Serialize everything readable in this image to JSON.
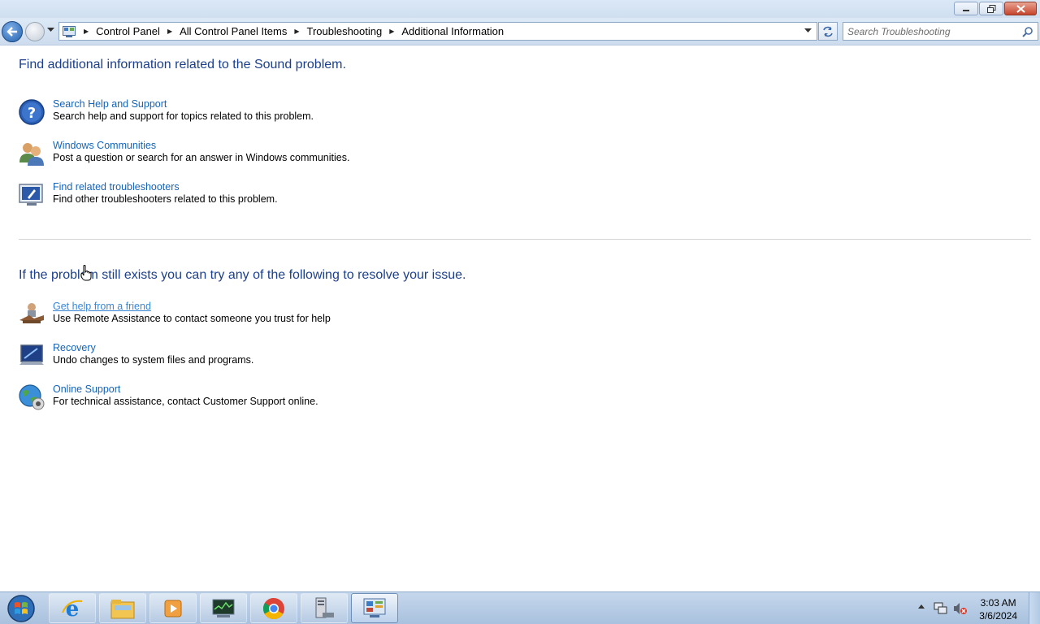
{
  "window": {
    "controls": [
      "minimize-icon",
      "restore-icon",
      "close-icon"
    ]
  },
  "address_bar": {
    "breadcrumbs": [
      "Control Panel",
      "All Control Panel Items",
      "Troubleshooting",
      "Additional Information"
    ]
  },
  "search": {
    "placeholder": "Search Troubleshooting"
  },
  "main": {
    "heading1": "Find additional information related to the Sound problem.",
    "section1": [
      {
        "title": "Search Help and Support",
        "description": "Search help and support for topics related to this problem.",
        "icon": "help-question-icon"
      },
      {
        "title": "Windows Communities",
        "description": "Post a question or search for an answer in Windows communities.",
        "icon": "communities-people-icon"
      },
      {
        "title": "Find related troubleshooters",
        "description": "Find other troubleshooters related to this problem.",
        "icon": "troubleshooter-monitor-icon"
      }
    ],
    "heading2": "If the problem still exists you can try any of the following to resolve your issue.",
    "section2": [
      {
        "title": "Get help from a friend",
        "description": "Use Remote Assistance to contact someone you trust for help",
        "icon": "remote-assistance-icon"
      },
      {
        "title": "Recovery",
        "description": "Undo changes to system files and programs.",
        "icon": "recovery-monitor-icon"
      },
      {
        "title": "Online Support",
        "description": "For technical assistance, contact Customer Support online.",
        "icon": "globe-icon"
      }
    ]
  },
  "taskbar": {
    "apps": [
      "internet-explorer-icon",
      "file-explorer-icon",
      "media-player-icon",
      "task-manager-icon",
      "chrome-icon",
      "server-icon",
      "control-panel-icon"
    ],
    "clock_time": "3:03 AM",
    "clock_date": "3/6/2024"
  },
  "colors": {
    "heading": "#1b3f8c",
    "link": "#1463b8",
    "taskbar": "#b7cde6"
  }
}
